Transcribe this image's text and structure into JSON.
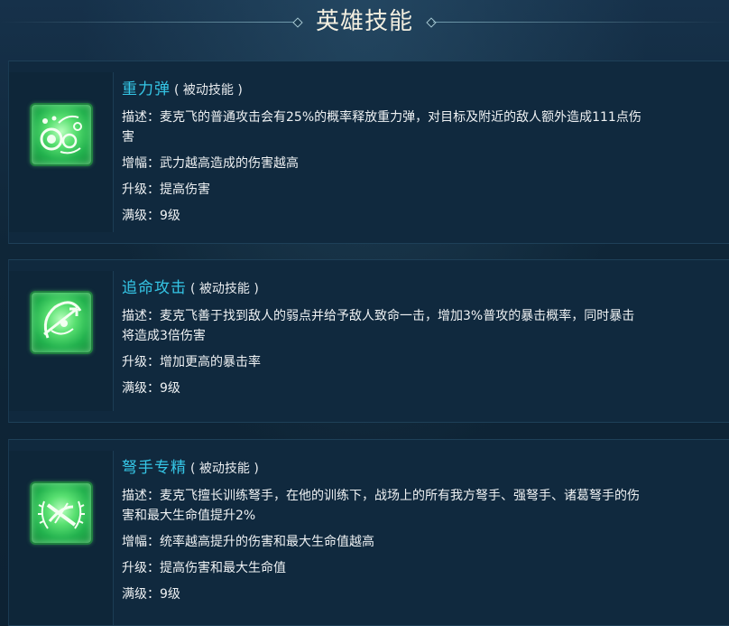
{
  "header": {
    "title": "英雄技能"
  },
  "skills": [
    {
      "name": "重力弹",
      "type": "( 被动技能 )",
      "icon": "gravity-orbs-icon",
      "desc_label": "描述：",
      "desc_line1": "麦克飞的普通攻击会有25%的概率释放重力弹，对目标及附近的敌人额外造成111点伤",
      "desc_line2": "害",
      "boost_label": "增幅：",
      "boost": "武力越高造成的伤害越高",
      "upgrade_label": "升级：",
      "upgrade": "提高伤害",
      "max_label": "满级：",
      "max": "9级"
    },
    {
      "name": "追命攻击",
      "type": "( 被动技能 )",
      "icon": "crossbow-target-icon",
      "desc_label": "描述：",
      "desc_line1": "麦克飞善于找到敌人的弱点并给予敌人致命一击，增加3%普攻的暴击概率，同时暴击",
      "desc_line2": "将造成3倍伤害",
      "upgrade_label": "升级：",
      "upgrade": "增加更高的暴击率",
      "max_label": "满级：",
      "max": "9级"
    },
    {
      "name": "弩手专精",
      "type": "( 被动技能 )",
      "icon": "crossbow-laurel-icon",
      "desc_label": "描述：",
      "desc_line1": "麦克飞擅长训练弩手，在他的训练下，战场上的所有我方弩手、强弩手、诸葛弩手的伤",
      "desc_line2": "害和最大生命值提升2%",
      "boost_label": "增幅：",
      "boost": "统率越高提升的伤害和最大生命值越高",
      "upgrade_label": "升级：",
      "upgrade": "提高伤害和最大生命值",
      "max_label": "满级：",
      "max": "9级"
    }
  ]
}
